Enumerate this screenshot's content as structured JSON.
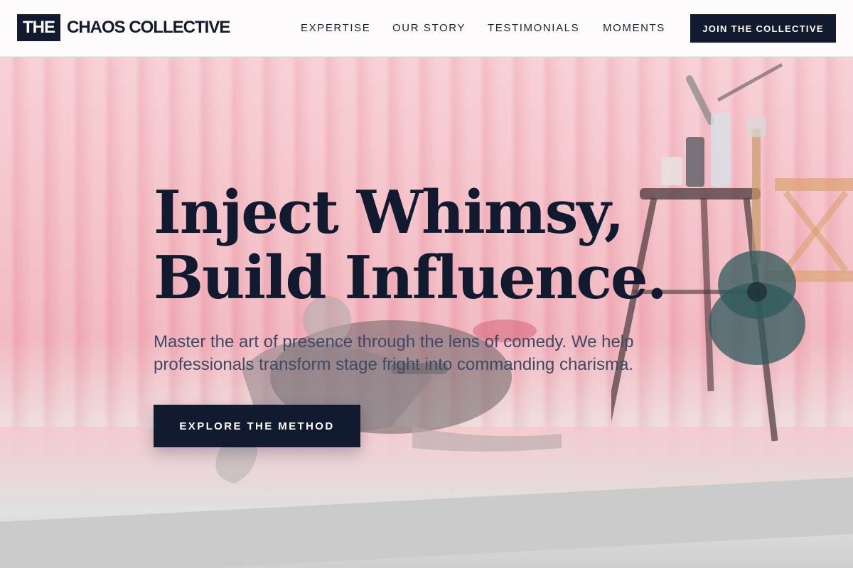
{
  "header": {
    "logo_mark": "THE",
    "logo_text": "CHAOS COLLECTIVE",
    "nav": [
      "EXPERTISE",
      "OUR STORY",
      "TESTIMONIALS",
      "MOMENTS"
    ],
    "cta": "JOIN THE COLLECTIVE"
  },
  "hero": {
    "headline_line1": "Inject Whimsy,",
    "headline_line2": "Build Influence.",
    "subhead": "Master the art of presence through the lens of comedy. We help professionals transform stage fright into commanding charisma.",
    "cta": "EXPLORE THE METHOD",
    "background_image": "comedian-on-stage-photo"
  },
  "colors": {
    "brand_navy": "#111a2e",
    "curtain_pink": "#f0aeb8",
    "subhead_gray": "#3e4a62"
  }
}
